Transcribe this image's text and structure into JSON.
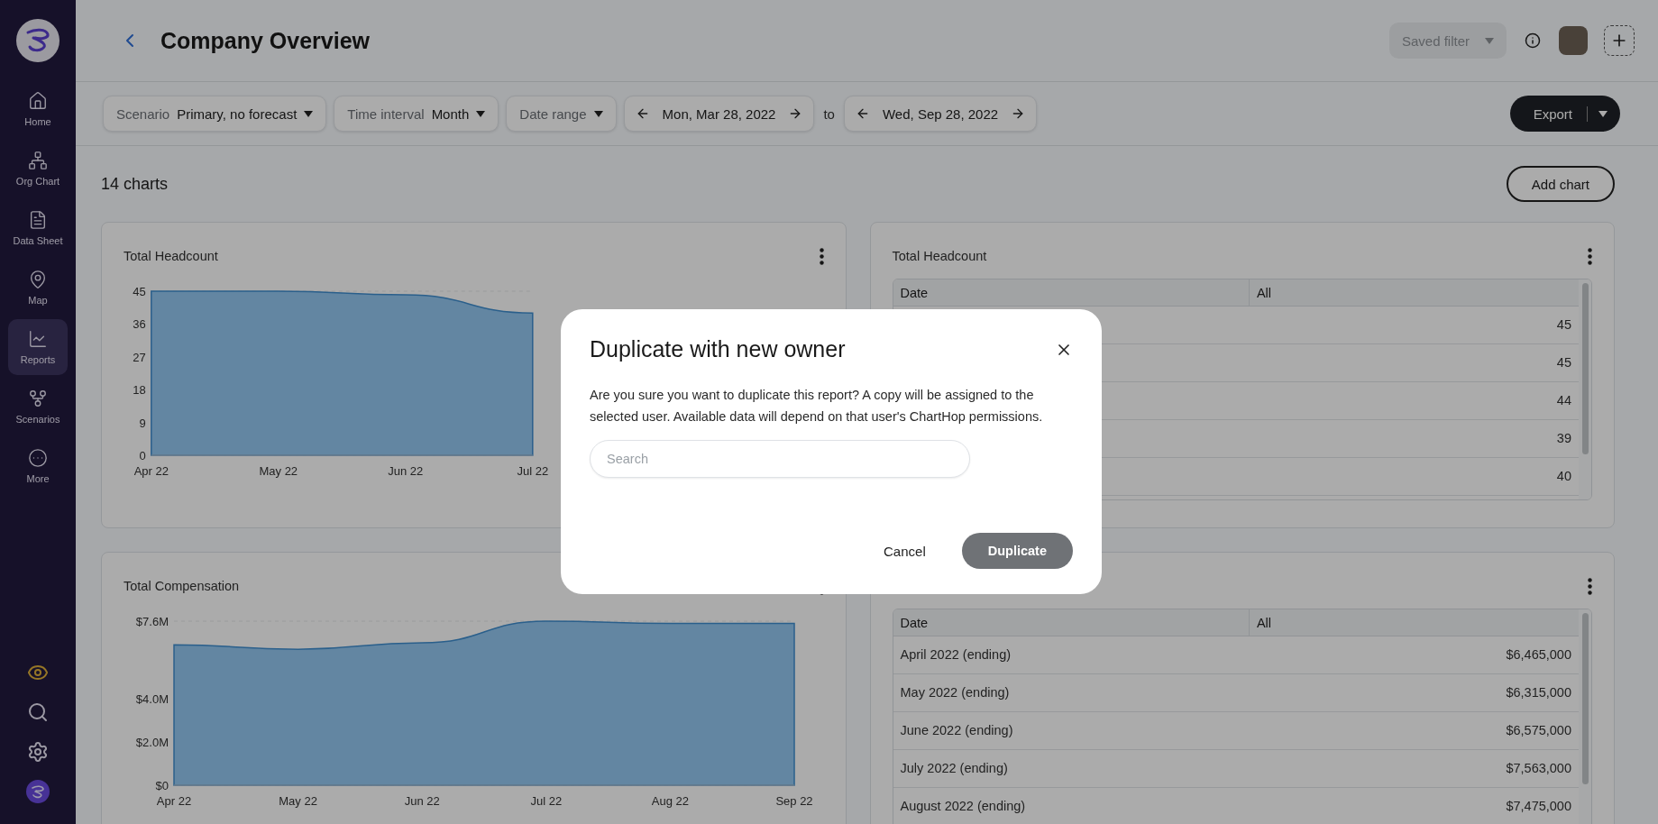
{
  "sidebar": {
    "items": [
      {
        "kind": "home",
        "label": "Home",
        "selected": false
      },
      {
        "kind": "org",
        "label": "Org Chart",
        "selected": false
      },
      {
        "kind": "sheet",
        "label": "Data Sheet",
        "selected": false
      },
      {
        "kind": "map",
        "label": "Map",
        "selected": false
      },
      {
        "kind": "reports",
        "label": "Reports",
        "selected": true
      },
      {
        "kind": "scenarios",
        "label": "Scenarios",
        "selected": false
      },
      {
        "kind": "more",
        "label": "More",
        "selected": false
      }
    ]
  },
  "header": {
    "title": "Company Overview",
    "saved_filter": {
      "label": "Saved filter",
      "disabled": true
    }
  },
  "filters": [
    {
      "label": "Scenario",
      "value": "Primary, no forecast"
    },
    {
      "label": "Time interval",
      "value": "Month"
    },
    {
      "label": "Date range"
    }
  ],
  "date_from": "Mon, Mar 28, 2022",
  "date_separator": "to",
  "date_to": "Wed, Sep 28, 2022",
  "export": "Export",
  "chart_count": "14 charts",
  "add_chart": "Add chart",
  "cards": [
    {
      "kind": "chart",
      "title": "Total Headcount",
      "chart_data": {
        "type": "area",
        "grid": true,
        "categories": [
          "Apr 22",
          "May 22",
          "Jun 22",
          "Jul 22"
        ],
        "ylim": [
          0,
          45
        ],
        "yticks": [
          0,
          9,
          18,
          27,
          36,
          45
        ],
        "series": [
          {
            "color": "#94c8f2",
            "values": [
              45,
              45,
              44,
              39
            ]
          }
        ]
      }
    },
    {
      "kind": "table",
      "title": "Total Headcount",
      "columns": [
        "Date",
        "All"
      ],
      "rows": [
        {
          "value": "45"
        },
        {
          "value": "45"
        },
        {
          "value": "44"
        },
        {
          "value": "39"
        },
        {
          "value": "40"
        }
      ]
    },
    {
      "kind": "chart",
      "title": "Total Compensation",
      "chart_data": {
        "type": "area",
        "grid": true,
        "categories": [
          "Apr 22",
          "May 22",
          "Jun 22",
          "Jul 22",
          "Aug 22",
          "Sep 22"
        ],
        "ylim": [
          0,
          7600000
        ],
        "yticks": [
          {
            "value": 0,
            "label": "$0"
          },
          {
            "value": 2000000,
            "label": "$2.0M"
          },
          {
            "value": 4000000,
            "label": "$4.0M"
          },
          {
            "value": 7600000,
            "label": "$7.6M"
          }
        ],
        "series": [
          {
            "color": "#94c8f2",
            "values": [
              6500000,
              6300000,
              6600000,
              7600000,
              7500000,
              7500000
            ]
          }
        ]
      }
    },
    {
      "kind": "table",
      "columns": [
        "Date",
        "All"
      ],
      "rows": [
        {
          "date": "April 2022 (ending)",
          "value": "$6,465,000"
        },
        {
          "date": "May 2022 (ending)",
          "value": "$6,315,000"
        },
        {
          "date": "June 2022 (ending)",
          "value": "$6,575,000"
        },
        {
          "date": "July 2022 (ending)",
          "value": "$7,563,000"
        },
        {
          "date": "August 2022 (ending)",
          "value": "$7,475,000"
        }
      ]
    }
  ],
  "modal": {
    "title": "Duplicate with new owner",
    "message": "Are you sure you want to duplicate this report? A copy will be assigned to the selected user. Available data will depend on that user's ChartHop permissions.",
    "search_placeholder": "Search",
    "cancel": "Cancel",
    "confirm": {
      "label": "Duplicate",
      "disabled": true
    }
  }
}
